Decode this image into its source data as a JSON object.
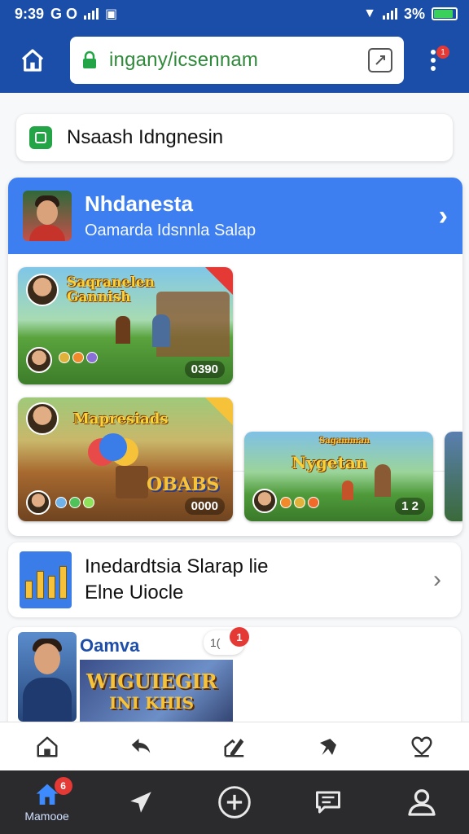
{
  "status_bar": {
    "time": "9:39",
    "carrier": "G O",
    "battery": "3%",
    "battery_level": 0.9
  },
  "browser": {
    "url": "inganу/icsennam",
    "menu_badge": "1"
  },
  "search_card": {
    "title": "Nsaash Idngnesin"
  },
  "featured": {
    "title": "Nhdanesta",
    "subtitle": "Oamarda Idsnnla Salap",
    "games": [
      {
        "title": "Saqranelen\nGannish",
        "score": "0390"
      },
      {
        "title": "Mapresiads",
        "badge_text": "OBABS",
        "score": "0000"
      },
      {
        "title": "Nygetan",
        "sub": "Sagamman",
        "score": "1 2"
      }
    ]
  },
  "list_card": {
    "line1": "Inedardtsia Slarap lie",
    "line2": "Elne Uiocle"
  },
  "promo_card": {
    "label": "Oamva",
    "banner_line1": "WIGUIEGIR",
    "banner_line2": "INI KHIS",
    "notif_text": "1(",
    "notif_badge": "1"
  },
  "bottom_nav": {
    "items": [
      {
        "label": "Mamooe",
        "icon": "home-icon",
        "badge": "6"
      },
      {
        "label": "",
        "icon": "send-icon"
      },
      {
        "label": "",
        "icon": "add-icon"
      },
      {
        "label": "",
        "icon": "chat-icon"
      },
      {
        "label": "",
        "icon": "profile-icon"
      }
    ]
  },
  "colors": {
    "header_blue": "#1b4ea8",
    "accent_blue": "#3d7ff0",
    "nav_bg": "#2b2b2e",
    "badge_red": "#e53935"
  }
}
